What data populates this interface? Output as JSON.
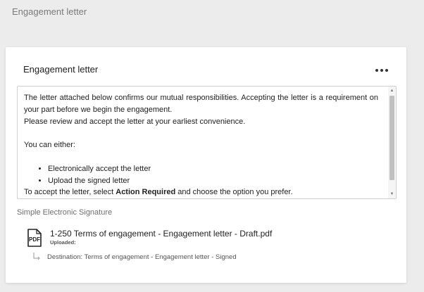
{
  "page": {
    "title": "Engagement letter"
  },
  "card": {
    "title": "Engagement letter",
    "more_icon": "more-horizontal-icon"
  },
  "letter": {
    "paragraph_1": "The letter attached below confirms our mutual responsibilities. Accepting the letter is a requirement on your part before we begin the engagement.",
    "paragraph_2": "Please review and accept the letter at your earliest convenience.",
    "paragraph_3": "You can either:",
    "options": [
      "Electronically accept the letter",
      "Upload the signed letter"
    ],
    "instruction_prefix": "To accept the letter, select ",
    "instruction_bold": "Action Required",
    "instruction_suffix": " and choose the option you prefer."
  },
  "signature": {
    "section_label": "Simple Electronic Signature",
    "file": {
      "icon": "pdf-file-icon",
      "icon_text": "PDF",
      "name": "1-250 Terms of engagement - Engagement letter - Draft.pdf",
      "meta": "Uploaded:"
    },
    "destination": {
      "icon": "return-arrow-icon",
      "text": "Destination: Terms of engagement - Engagement letter - Signed"
    }
  },
  "colors": {
    "background": "#ececec",
    "card": "#ffffff",
    "border": "#d0d0d0",
    "scroll_thumb": "#c1c1c1"
  }
}
